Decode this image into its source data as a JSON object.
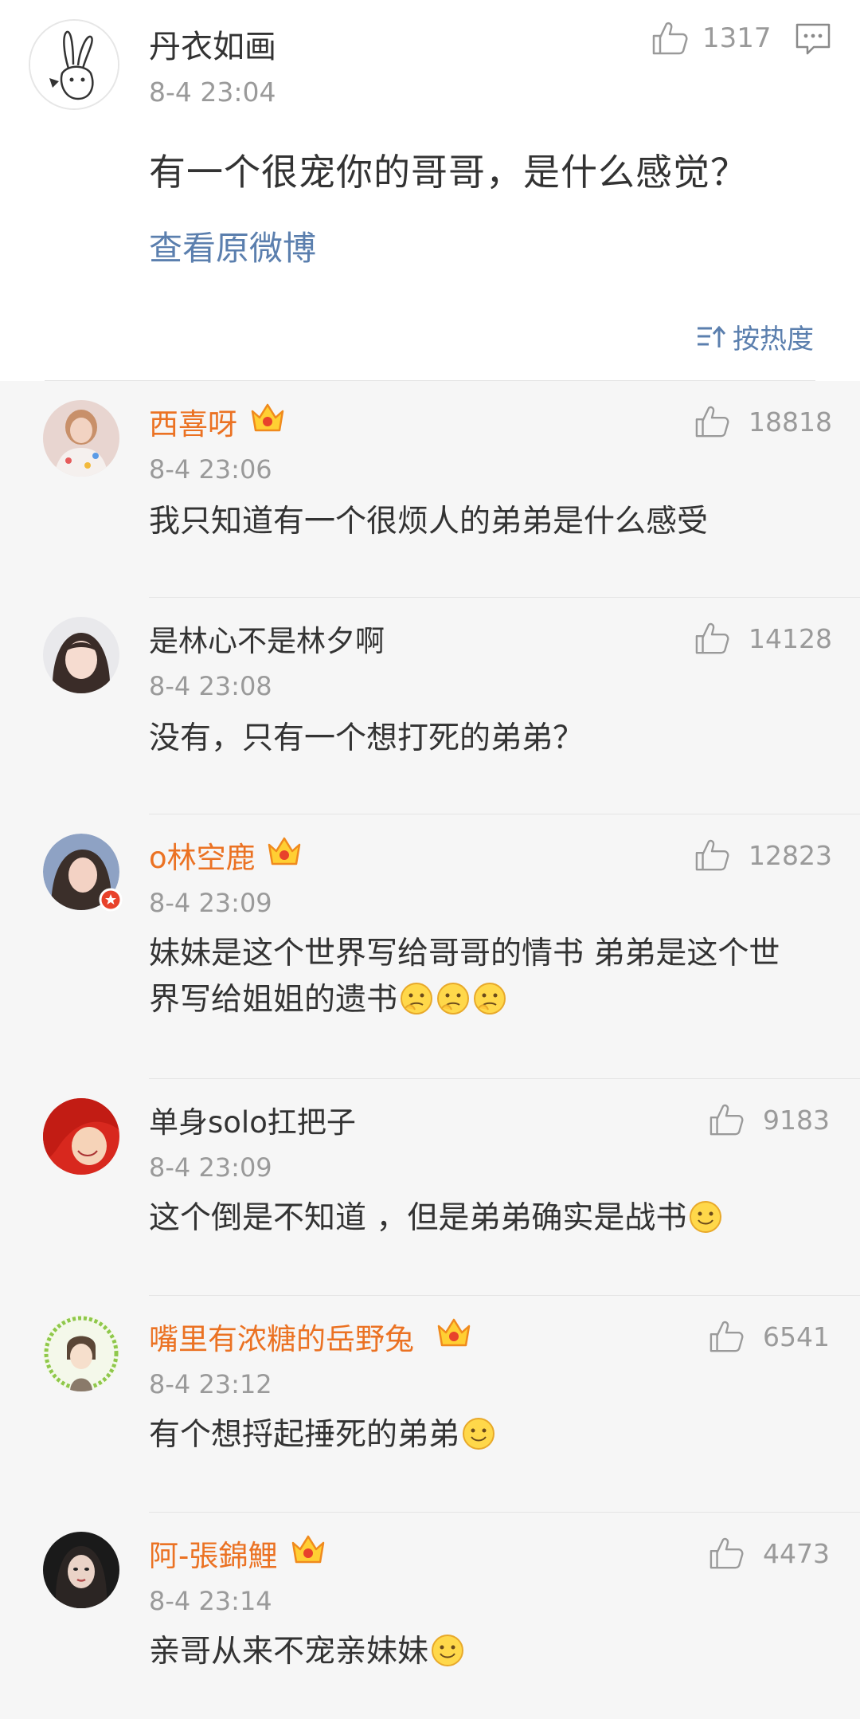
{
  "post": {
    "author": "丹衣如画",
    "time": "8-4 23:04",
    "likes": "1317",
    "text": "有一个很宠你的哥哥，是什么感觉？",
    "view_original": "查看原微博",
    "sort_label": "按热度"
  },
  "comments": [
    {
      "name": "西喜呀",
      "vip": true,
      "time": "8-4 23:06",
      "likes": "18818",
      "text": "我只知道有一个很烦人的弟弟是什么感受"
    },
    {
      "name": "是林心不是林夕啊",
      "vip": false,
      "time": "8-4 23:08",
      "likes": "14128",
      "text": "没有，只有一个想打死的弟弟？"
    },
    {
      "name": "o林空鹿",
      "vip": true,
      "time": "8-4 23:09",
      "likes": "12823",
      "text": "妹妹是这个世界写给哥哥的情书 弟弟是这个世界写给姐姐的遗书"
    },
    {
      "name": "单身solo扛把子",
      "vip": false,
      "time": "8-4 23:09",
      "likes": "9183",
      "text": "这个倒是不知道 ，但是弟弟确实是战书"
    },
    {
      "name": "嘴里有浓糖的岳野兔",
      "vip": true,
      "time": "8-4 23:12",
      "likes": "6541",
      "text": "有个想捋起捶死的弟弟"
    },
    {
      "name": "阿-張錦鯉",
      "vip": true,
      "time": "8-4 23:14",
      "likes": "4473",
      "text": "亲哥从来不宠亲妹妹"
    }
  ],
  "colors": {
    "vip_name": "#eb7223",
    "link": "#5b7fae",
    "meta": "#9a9a9a"
  }
}
